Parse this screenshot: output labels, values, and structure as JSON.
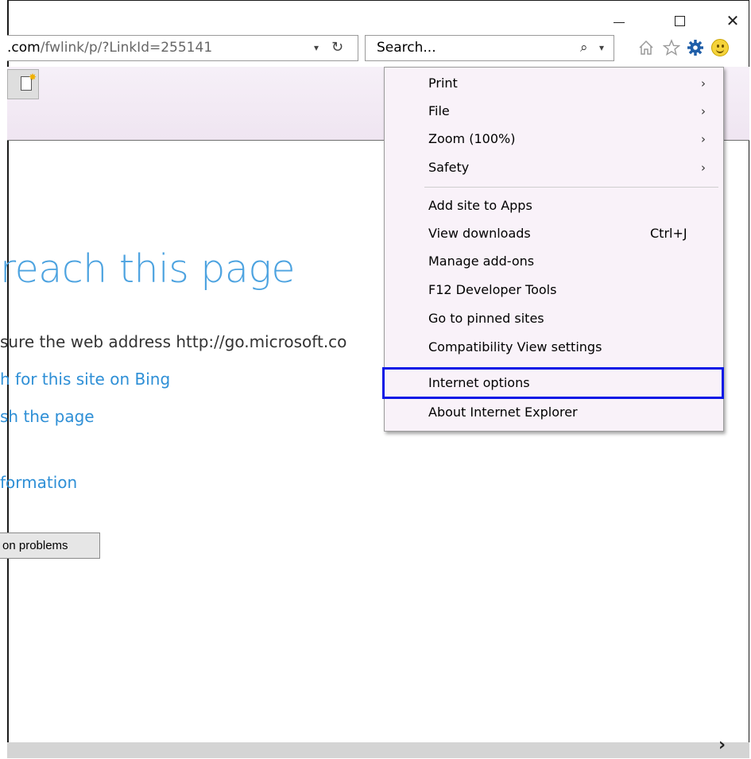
{
  "window": {
    "minimize_glyph": "—",
    "close_glyph": "✕"
  },
  "address_bar": {
    "url_domain": ".com",
    "url_path": "/fwlink/p/?LinkId=255141",
    "dropdown_glyph": "▾",
    "refresh_glyph": "↻"
  },
  "search_box": {
    "placeholder": "Search...",
    "search_glyph": "⌕",
    "dropdown_glyph": "▾"
  },
  "toolbar_icons": [
    "home-icon",
    "favorites-star-icon",
    "tools-gear-icon",
    "feedback-smiley-icon"
  ],
  "page": {
    "heading": "reach this page",
    "body_text": "sure the web address http://go.microsoft.co",
    "link_search": "h for this site on Bing",
    "link_refresh": "sh the page",
    "more_info": "formation",
    "fix_button": "on problems"
  },
  "tools_menu": {
    "items": [
      {
        "label": "Print",
        "submenu": true
      },
      {
        "label": "File",
        "submenu": true
      },
      {
        "label": "Zoom (100%)",
        "submenu": true
      },
      {
        "label": "Safety",
        "submenu": true
      },
      {
        "label": "Add site to Apps",
        "submenu": false
      },
      {
        "label": "View downloads",
        "shortcut": "Ctrl+J",
        "submenu": false
      },
      {
        "label": "Manage add-ons",
        "submenu": false
      },
      {
        "label": "F12 Developer Tools",
        "submenu": false
      },
      {
        "label": "Go to pinned sites",
        "submenu": false
      },
      {
        "label": "Compatibility View settings",
        "submenu": false
      },
      {
        "label": "Internet options",
        "submenu": false,
        "highlighted": true
      },
      {
        "label": "About Internet Explorer",
        "submenu": false
      }
    ],
    "submenu_arrow": "›",
    "highlight_color": "#0a19e6"
  },
  "scrollbar": {
    "right_arrow": "›"
  }
}
